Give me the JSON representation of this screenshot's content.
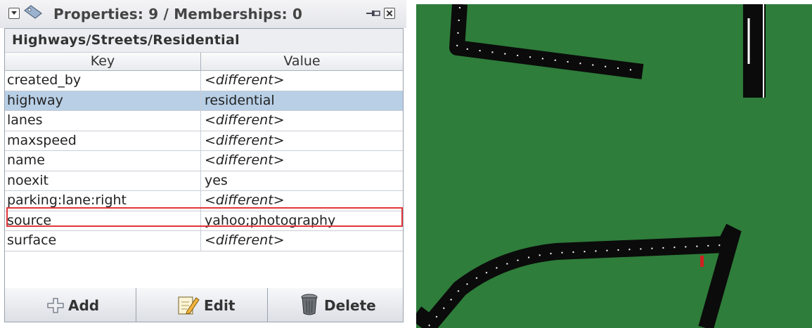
{
  "panel": {
    "title": "Properties: 9 / Memberships: 0",
    "preset": "Highways/Streets/Residential",
    "headers": {
      "key": "Key",
      "value": "Value"
    },
    "rows": [
      {
        "key": "created_by",
        "value": "<different>"
      },
      {
        "key": "highway",
        "value": "residential"
      },
      {
        "key": "lanes",
        "value": "<different>"
      },
      {
        "key": "maxspeed",
        "value": "<different>"
      },
      {
        "key": "name",
        "value": "<different>"
      },
      {
        "key": "noexit",
        "value": "yes"
      },
      {
        "key": "parking:lane:right",
        "value": "<different>"
      },
      {
        "key": "source",
        "value": "yahoo;photography"
      },
      {
        "key": "surface",
        "value": "<different>"
      }
    ],
    "buttons": {
      "add": "Add",
      "edit": "Edit",
      "delete": "Delete"
    }
  },
  "colors": {
    "selection": "#b8cfe6",
    "highlight": "#e0373a",
    "map_background": "#2e7d3a",
    "road": "#0b0b0b"
  }
}
